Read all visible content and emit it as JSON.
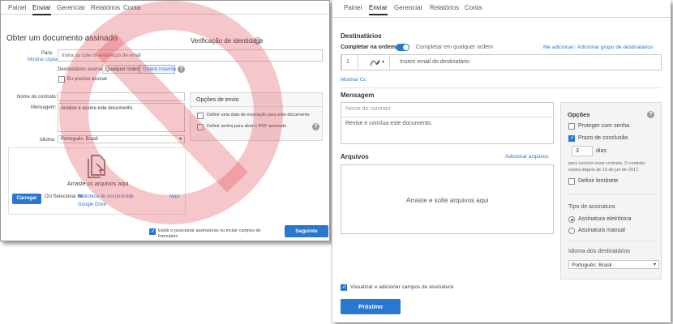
{
  "colors": {
    "accent": "#2b76d1",
    "prohibition": "#e0464f",
    "border": "#c8c8c8"
  },
  "old_ui": {
    "tabs": [
      "Painel",
      "Enviar",
      "Gerenciar",
      "Relatórios",
      "Conta"
    ],
    "active_tab": "Enviar",
    "page_title": "Obter um documento assinado",
    "identity_verification": "Verificação de identidade",
    "to_label": "Para:",
    "show_copy": "Mostrar cópia",
    "to_placeholder": "Insira ou cole os endereços de email",
    "recipients_sign_label": "Destinatários assinam",
    "sign_order_any": "Qualquer ordem",
    "sign_order_seq": "Ordem inserida",
    "i_need_sign": "Eu preciso assinar",
    "contract_name_label": "Nome do contrato:",
    "message_label": "Mensagem:",
    "message_value": "Analise e assine este documento.",
    "language_label": "Idioma",
    "language_value": "Português: Brasil",
    "send_options_title": "Opções de envio",
    "option_expiration": "Definir uma data de expiração para este documento",
    "option_password": "Definir senha para abrir o PDF assinado",
    "drop_text": "Arraste os arquivos aqui",
    "upload_button": "Carregar",
    "or_select_from": "OU Selecionar de:",
    "document_library": "Biblioteca de documentos",
    "google_drive": "Google Drive",
    "more": "Mais",
    "preview_fields": "Exibir e posicionar assinaturas ou incluir campos de formulário",
    "next_button": "Seguinte",
    "prohibited_icon": "prohibited-icon"
  },
  "new_ui": {
    "tabs": [
      "Painel",
      "Enviar",
      "Gerenciar",
      "Relatórios",
      "Conta"
    ],
    "active_tab": "Enviar",
    "recipients_title": "Destinatários",
    "complete_in_order": "Completar na ordem",
    "complete_any_order": "Completar em qualquer ordem",
    "add_me": "Me adicionar",
    "add_group": "Adicionar grupo de destinatários",
    "recipient_number": "1",
    "recipient_placeholder": "Inserir email do destinatário",
    "show_cc": "Mostrar Cc",
    "message_title": "Mensagem",
    "contract_placeholder": "Nome do contrato",
    "message_value": "Revise e conclua este documento.",
    "files_title": "Arquivos",
    "add_files": "Adicionar arquivos",
    "drop_text": "Arraste e solte arquivos aqui",
    "options_title": "Opções",
    "protect_password": "Proteger com senha",
    "completion_deadline": "Prazo de conclusão",
    "days_value": "3",
    "days_label": "dias",
    "deadline_note_line1": "para concluir esse contrato. O contrato",
    "deadline_note_line2": "expira depois de 10 de jun de 2017.",
    "set_reminder": "Definir lembrete",
    "signature_type_title": "Tipo de assinatura",
    "electronic_signature": "Assinatura eletrônica",
    "manual_signature": "Assinatura manual",
    "recipient_language_title": "Idioma dos destinatários",
    "language_value": "Português: Brasil",
    "preview_fields": "Visualizar e adicionar campos de assinatura",
    "next_button": "Próximo"
  }
}
